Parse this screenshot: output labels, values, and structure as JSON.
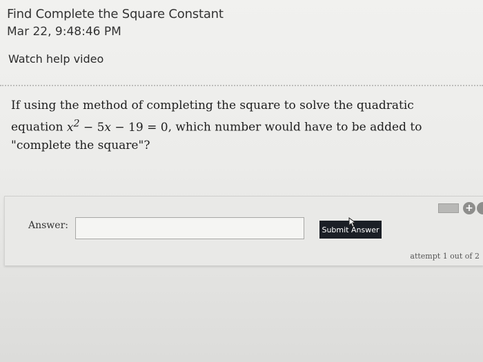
{
  "header": {
    "title": "Find Complete the Square Constant",
    "datetime": "Mar 22, 9:48:46 PM",
    "help_link": "Watch help video"
  },
  "question": {
    "text_before": "If using the method of completing the square to solve the quadratic equation",
    "equation": {
      "var": "x",
      "exp": "2",
      "op1": "−",
      "coef": "5",
      "var2": "x",
      "op2": "−",
      "const": "19",
      "eq": "=",
      "rhs": "0"
    },
    "text_after": ", which number would have to be added to \"complete the square\"?"
  },
  "answer": {
    "label": "Answer:",
    "value": "",
    "placeholder": "",
    "submit_label": "Submit Answer",
    "attempt_text": "attempt 1 out of 2"
  },
  "icons": {
    "keyboard": "keyboard-icon",
    "plus": "plus-circle-icon",
    "plus_glyph": "+",
    "cursor": "mouse-cursor-icon"
  }
}
